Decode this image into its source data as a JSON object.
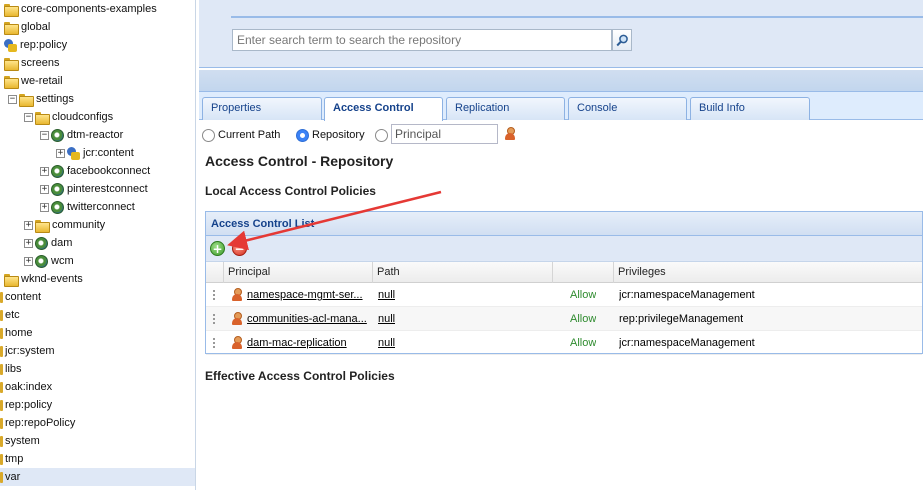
{
  "tree": {
    "nodes": [
      {
        "label": "core-components-examples",
        "icon": "folder-icon"
      },
      {
        "label": "global",
        "icon": "folder-icon"
      },
      {
        "label": "rep:policy",
        "icon": "policy-icon"
      },
      {
        "label": "screens",
        "icon": "folder-icon"
      },
      {
        "label": "we-retail",
        "icon": "folder-icon"
      },
      {
        "label": "settings",
        "icon": "folder-icon"
      },
      {
        "label": "cloudconfigs",
        "icon": "folder-icon"
      },
      {
        "label": "dtm-reactor",
        "icon": "config-node-icon"
      },
      {
        "label": "jcr:content",
        "icon": "content-node-icon"
      },
      {
        "label": "facebookconnect",
        "icon": "config-node-icon"
      },
      {
        "label": "pinterestconnect",
        "icon": "config-node-icon"
      },
      {
        "label": "twitterconnect",
        "icon": "config-node-icon"
      },
      {
        "label": "community",
        "icon": "folder-icon"
      },
      {
        "label": "dam",
        "icon": "config-node-icon"
      },
      {
        "label": "wcm",
        "icon": "config-node-icon"
      },
      {
        "label": "wknd-events",
        "icon": "folder-icon"
      },
      {
        "label": "content",
        "icon": "folder-icon"
      },
      {
        "label": "etc",
        "icon": "folder-icon"
      },
      {
        "label": "home",
        "icon": "folder-icon"
      },
      {
        "label": "jcr:system",
        "icon": "folder-icon"
      },
      {
        "label": "libs",
        "icon": "folder-icon"
      },
      {
        "label": "oak:index",
        "icon": "folder-icon"
      },
      {
        "label": "rep:policy",
        "icon": "folder-icon"
      },
      {
        "label": "rep:repoPolicy",
        "icon": "folder-icon"
      },
      {
        "label": "system",
        "icon": "folder-icon"
      },
      {
        "label": "tmp",
        "icon": "folder-icon"
      },
      {
        "label": "var",
        "icon": "folder-icon",
        "selected": true
      }
    ]
  },
  "search": {
    "placeholder": "Enter search term to search the repository",
    "icon": "search-icon"
  },
  "tabs": [
    {
      "label": "Properties",
      "active": false
    },
    {
      "label": "Access Control",
      "active": true
    },
    {
      "label": "Replication",
      "active": false
    },
    {
      "label": "Console",
      "active": false
    },
    {
      "label": "Build Info",
      "active": false
    }
  ],
  "scope": {
    "current_path": "Current Path",
    "repository": "Repository",
    "principal_placeholder": "Principal",
    "selected": "Repository"
  },
  "page": {
    "title": "Access Control - Repository",
    "local_heading": "Local Access Control Policies",
    "effective_heading": "Effective Access Control Policies"
  },
  "acl": {
    "title": "Access Control List",
    "columns": {
      "principal": "Principal",
      "path": "Path",
      "allow": "",
      "privileges": "Privileges"
    },
    "rows": [
      {
        "principal": "namespace-mgmt-ser...",
        "path": "null",
        "allow": "Allow",
        "privileges": "jcr:namespaceManagement"
      },
      {
        "principal": "communities-acl-mana...",
        "path": "null",
        "allow": "Allow",
        "privileges": "rep:privilegeManagement"
      },
      {
        "principal": "dam-mac-replication",
        "path": "null",
        "allow": "Allow",
        "privileges": "jcr:namespaceManagement"
      }
    ]
  },
  "colors": {
    "accent": "#15428b",
    "panel_bg": "#dfe8f6",
    "allow": "#2e8b2e",
    "arrow": "#e53935"
  }
}
